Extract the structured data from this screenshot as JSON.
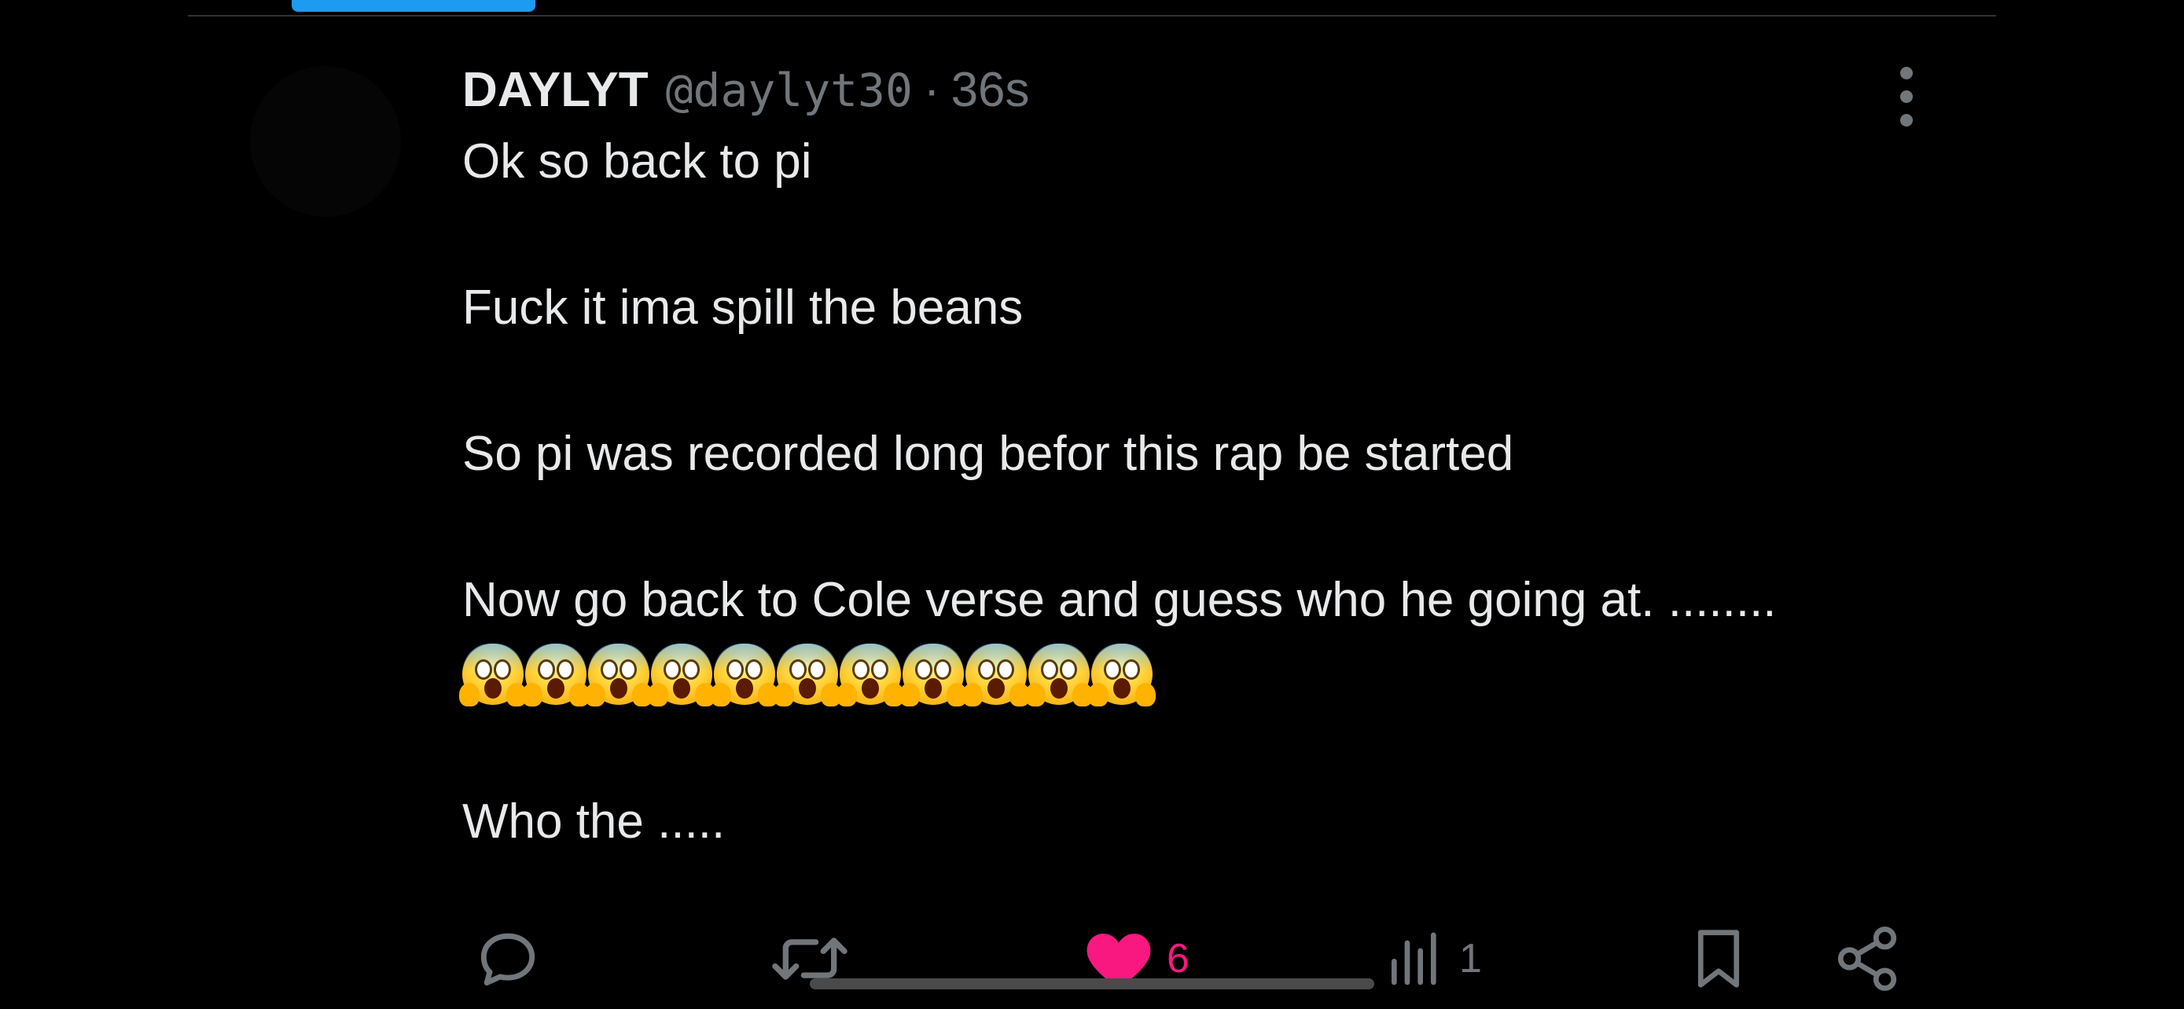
{
  "tweet": {
    "display_name": "DAYLYT",
    "handle": "@daylyt30",
    "separator": "·",
    "time": "36s",
    "lines": [
      "Ok so back to pi",
      "Fuck it ima spill the beans",
      "So pi was recorded long befor this rap be started",
      "Now go back to Cole verse and guess who he going at. ........"
    ],
    "emoji": "😱",
    "emoji_count": 11,
    "last_line": "Who the ....."
  },
  "actions": {
    "reply_count": "",
    "retweet_count": "",
    "like_count": "6",
    "views_count": "1"
  },
  "colors": {
    "background": "#000000",
    "text": "#e7e9ea",
    "muted": "#71767b",
    "like": "#f91880",
    "accent": "#1d9bf0"
  },
  "icons": [
    "reply-icon",
    "retweet-icon",
    "like-icon",
    "views-icon",
    "bookmark-icon",
    "share-icon",
    "more-icon",
    "face-screaming-in-fear-emoji"
  ]
}
